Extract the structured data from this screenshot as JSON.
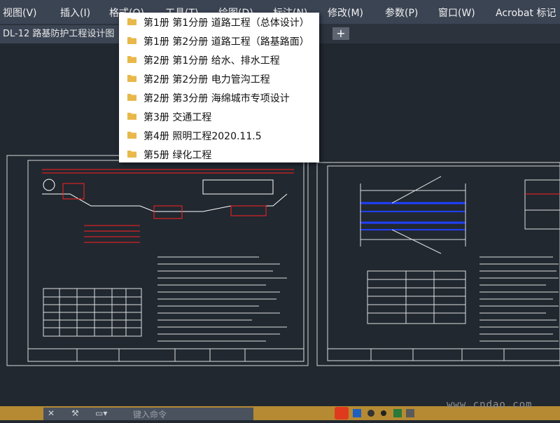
{
  "menu": {
    "items": [
      "视图(V)",
      "插入(I)",
      "格式(O)",
      "工具(T)",
      "绘图(D)",
      "标注(N)",
      "修改(M)",
      "参数(P)",
      "窗口(W)",
      "Acrobat 标记"
    ]
  },
  "tabs": {
    "active_label": "DL-12 路基防护工程设计图",
    "add_label": "+"
  },
  "dropdown": {
    "items": [
      "第1册 第1分册 道路工程（总体设计）",
      "第1册 第2分册 道路工程（路基路面）",
      "第2册 第1分册 给水、排水工程",
      "第2册 第2分册 电力管沟工程",
      "第2册 第3分册 海绵城市专项设计",
      "第3册 交通工程",
      "第4册 照明工程2020.11.5",
      "第5册 绿化工程"
    ]
  },
  "command": {
    "placeholder": "键入命令"
  },
  "watermark": "www.cndao.com",
  "colors": {
    "menubar": "#3b4453",
    "canvas": "#212830",
    "statusbar": "#b58a32",
    "folder": "#e8b84a",
    "drawing_red": "#ff2020",
    "drawing_blue": "#2040ff"
  }
}
